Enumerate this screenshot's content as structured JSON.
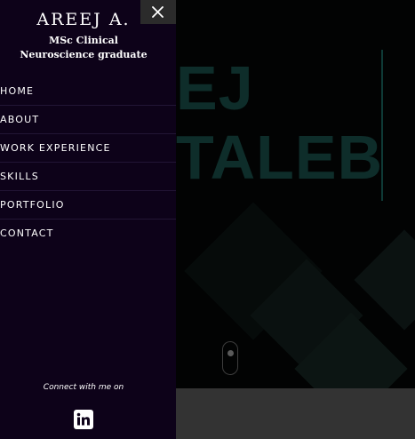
{
  "hero": {
    "name_line1": "EJ",
    "name_line2": "TALEB"
  },
  "sidebar": {
    "brand_name": "AREEJ A.",
    "brand_subtitle": "MSc Clinical Neuroscience graduate",
    "nav_items": [
      {
        "label": "HOME"
      },
      {
        "label": "ABOUT"
      },
      {
        "label": "WORK EXPERIENCE"
      },
      {
        "label": "SKILLS"
      },
      {
        "label": "PORTFOLIO"
      },
      {
        "label": "CONTACT"
      }
    ],
    "connect_text": "Connect with me on",
    "social_icon": "linkedin-icon",
    "close_icon": "close-icon"
  },
  "colors": {
    "sidebar_bg": "#0d0219",
    "hero_text": "#0e2d2a",
    "close_bg": "#2b2b2b",
    "footer_strip": "#333333"
  }
}
